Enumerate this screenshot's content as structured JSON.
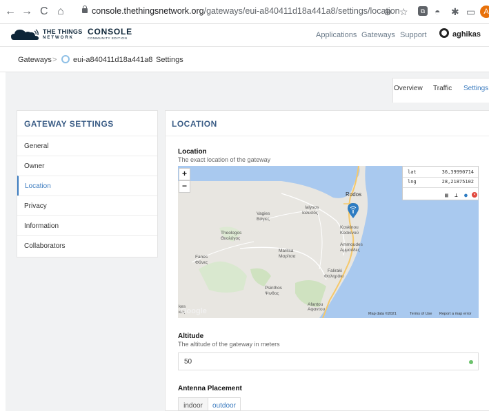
{
  "browser": {
    "url_host": "console.thethingsnetwork.org",
    "url_path": "/gateways/eui-a840411d18a441a8/settings/location",
    "profile_initial": "A",
    "back_glyph": "←",
    "forward_glyph": "→",
    "reload_glyph": "C",
    "home_glyph": "⌂",
    "zoom_glyph": "⊕",
    "star_glyph": "☆",
    "ext_glyph": "⧉",
    "puzzle_glyph": "✱",
    "cast_glyph": "▭"
  },
  "header": {
    "brand_line1": "THE THINGS",
    "brand_line1b": "NETWORK",
    "brand_line2": "CONSOLE",
    "brand_line2b": "COMMUNITY EDITION",
    "nav": [
      "Applications",
      "Gateways",
      "Support"
    ],
    "username": "aghikas"
  },
  "breadcrumb": {
    "root": "Gateways",
    "gateway": "eui-a840411d18a441a8",
    "current": "Settings",
    "separator": ">"
  },
  "tabs": [
    "Overview",
    "Traffic",
    "Settings"
  ],
  "active_tab": "Settings",
  "sidebar": {
    "title": "GATEWAY SETTINGS",
    "items": [
      "General",
      "Owner",
      "Location",
      "Privacy",
      "Information",
      "Collaborators"
    ],
    "active": "Location"
  },
  "content": {
    "title": "LOCATION",
    "location_label": "Location",
    "location_help": "The exact location of the gateway",
    "coordinates": {
      "lat_label": "lat",
      "lat_value": "36,39990714",
      "lng_label": "lng",
      "lng_value": "28,21875102"
    },
    "map_zoom_in": "+",
    "map_zoom_out": "−",
    "map_places": [
      {
        "name": "Rodos"
      },
      {
        "name": "Ialysos"
      },
      {
        "name": "Ιαλυσός"
      },
      {
        "name": "Vagies"
      },
      {
        "name": "Βάγιες"
      },
      {
        "name": "Koskinou"
      },
      {
        "name": "Κοσκινού"
      },
      {
        "name": "Theologos"
      },
      {
        "name": "Θεολόγος"
      },
      {
        "name": "Ammoudes"
      },
      {
        "name": "Αμμούδες"
      },
      {
        "name": "Maritsa"
      },
      {
        "name": "Μαρίτσα"
      },
      {
        "name": "Fanes"
      },
      {
        "name": "Φάνες"
      },
      {
        "name": "Faliraki"
      },
      {
        "name": "Φαληράκι"
      },
      {
        "name": "Psinthos"
      },
      {
        "name": "Ψινθος"
      },
      {
        "name": "Afantou"
      },
      {
        "name": "Αφαντου"
      },
      {
        "name": "kes"
      },
      {
        "name": "κες"
      }
    ],
    "map_logo": "Google",
    "map_footer": [
      "Map data ©2021",
      "Terms of Use",
      "Report a map error"
    ],
    "altitude_label": "Altitude",
    "altitude_help": "The altitude of the gateway in meters",
    "altitude_value": "50",
    "antenna_label": "Antenna Placement",
    "antenna_options": [
      "indoor",
      "outdoor"
    ],
    "antenna_selected": "outdoor"
  },
  "colors": {
    "accent": "#3b7bbf",
    "heading": "#3b5d86",
    "sea": "#a9c9ef",
    "land": "#e8e6e1",
    "status_ok": "#6cc26c"
  }
}
